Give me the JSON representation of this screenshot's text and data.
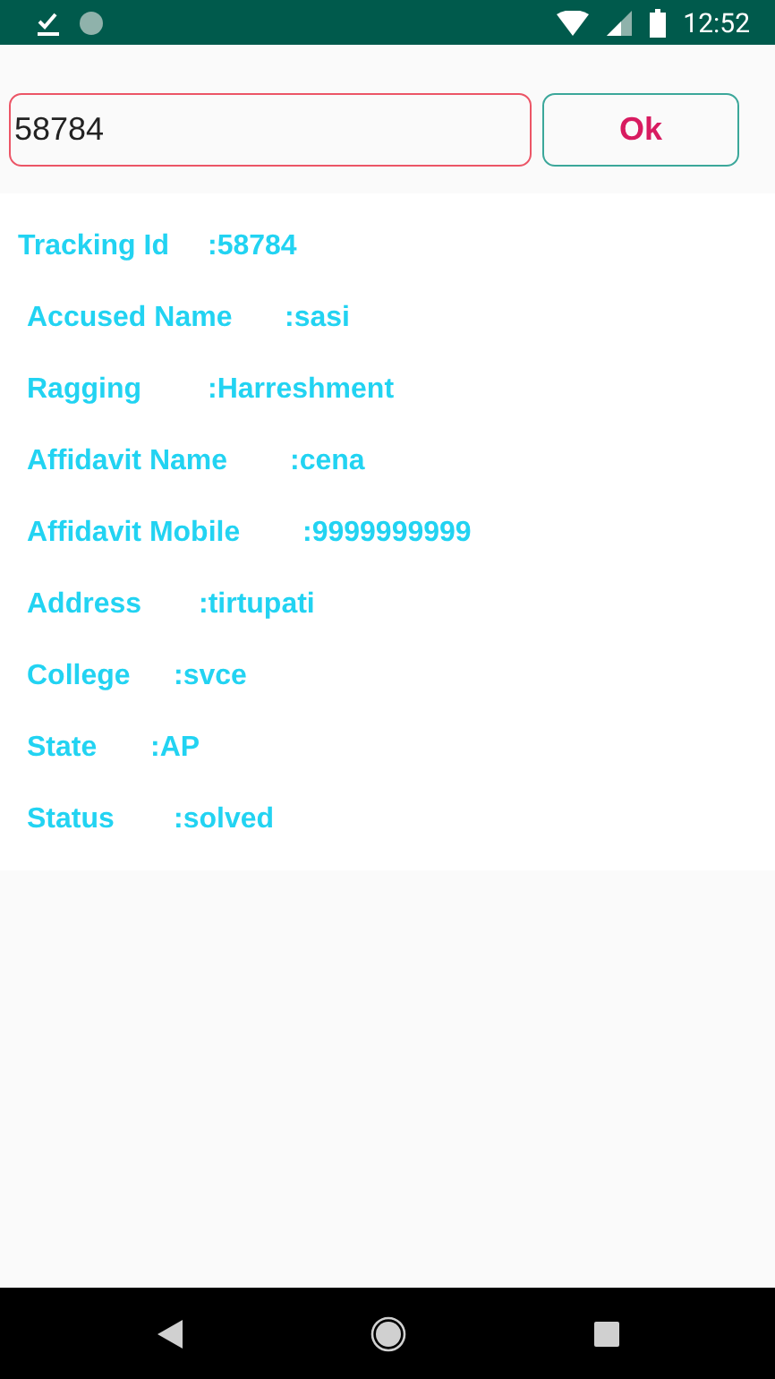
{
  "status_bar": {
    "time": "12:52"
  },
  "search": {
    "value": "58784",
    "button": "Ok"
  },
  "details": [
    {
      "label": "Tracking Id",
      "value": ":58784"
    },
    {
      "label": "Accused Name",
      "value": ":sasi"
    },
    {
      "label": "Ragging",
      "value": ":Harreshment"
    },
    {
      "label": "Affidavit Name",
      "value": ":cena"
    },
    {
      "label": "Affidavit Mobile",
      "value": ":9999999999"
    },
    {
      "label": "Address",
      "value": ":tirtupati"
    },
    {
      "label": "College",
      "value": ":svce"
    },
    {
      "label": "State",
      "value": ":AP"
    },
    {
      "label": "Status",
      "value": ":solved"
    }
  ]
}
